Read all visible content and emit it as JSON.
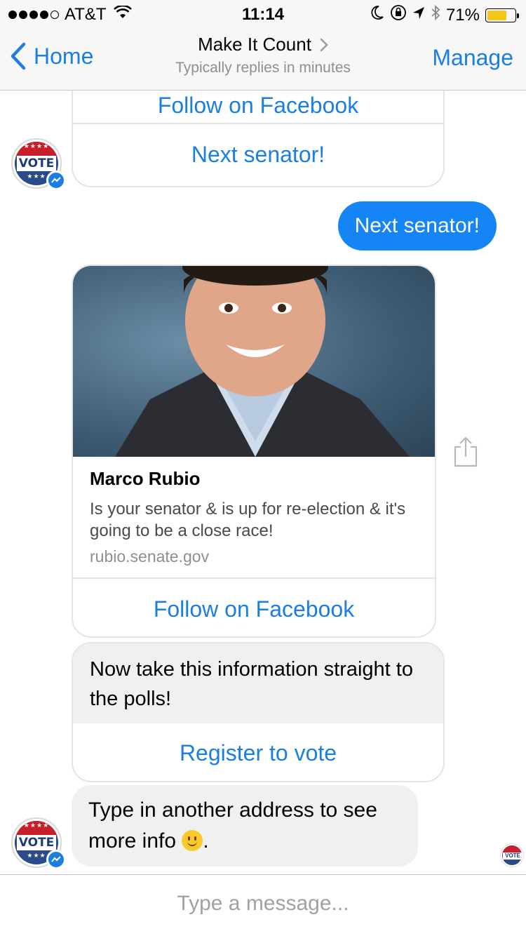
{
  "status_bar": {
    "carrier": "AT&T",
    "time": "11:14",
    "battery_percent": "71%"
  },
  "nav": {
    "back_label": "Home",
    "title": "Make It Count",
    "subtitle": "Typically replies in minutes",
    "manage_label": "Manage"
  },
  "messages": {
    "top_card": {
      "button1": "Follow on Facebook",
      "button2": "Next senator!"
    },
    "outgoing": "Next senator!",
    "senator_card": {
      "name": "Marco Rubio",
      "description": "Is your senator & is up for re-election & it's going to be a close race!",
      "url": "rubio.senate.gov",
      "button": "Follow on Facebook"
    },
    "polls_card": {
      "text": "Now take this information straight to the polls!",
      "button": "Register to vote"
    },
    "last_message": "Type in another address to see more info",
    "avatar_label": "VOTE"
  },
  "composer": {
    "placeholder": "Type a message..."
  },
  "colors": {
    "accent": "#1a7fe0",
    "outgoing_bubble": "#1585f5",
    "incoming_bubble": "#f0f0f0"
  }
}
